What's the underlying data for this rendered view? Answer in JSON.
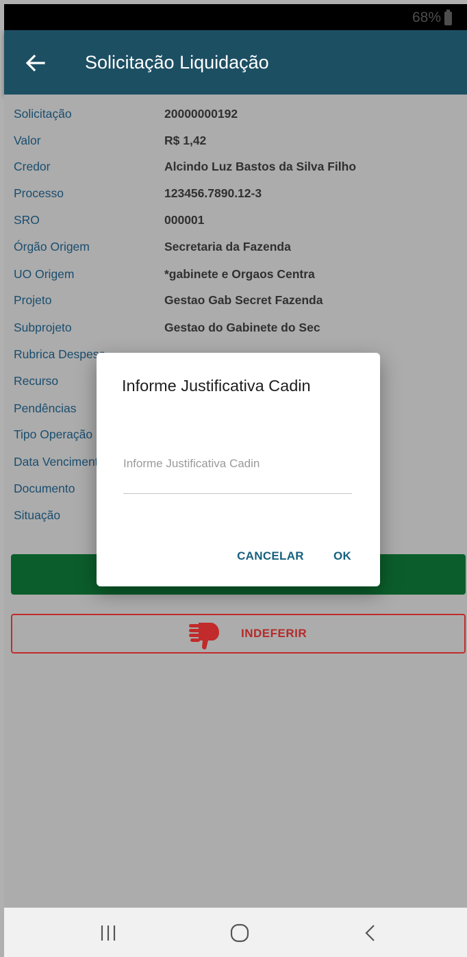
{
  "status_bar": {
    "battery": "68%"
  },
  "app_bar": {
    "title": "Solicitação Liquidação"
  },
  "fields": [
    {
      "label": "Solicitação",
      "value": "20000000192"
    },
    {
      "label": "Valor",
      "value": "R$ 1,42"
    },
    {
      "label": "Credor",
      "value": "Alcindo Luz Bastos da Silva Filho"
    },
    {
      "label": "Processo",
      "value": "123456.7890.12-3"
    },
    {
      "label": "SRO",
      "value": "000001"
    },
    {
      "label": "Órgão Origem",
      "value": "Secretaria da Fazenda"
    },
    {
      "label": "UO Origem",
      "value": "*gabinete e Orgaos Centra"
    },
    {
      "label": "Projeto",
      "value": "Gestao Gab Secret Fazenda"
    },
    {
      "label": "Subprojeto",
      "value": "Gestao do Gabinete do Sec"
    },
    {
      "label": "Rubrica Despesa",
      "value": ""
    },
    {
      "label": "Recurso",
      "value": ""
    },
    {
      "label": "Pendências",
      "value": ""
    },
    {
      "label": "Tipo Operação",
      "value": ""
    },
    {
      "label": "Data Vencimento",
      "value": ""
    },
    {
      "label": "Documento",
      "value": ""
    },
    {
      "label": "Situação",
      "value": ""
    }
  ],
  "actions": {
    "reject_label": "INDEFERIR"
  },
  "dialog": {
    "title": "Informe Justificativa Cadin",
    "input_placeholder": "Informe Justificativa Cadin",
    "input_value": "",
    "cancel_label": "CANCELAR",
    "ok_label": "OK"
  },
  "colors": {
    "app_bar": "#1d4f63",
    "approve": "#0b5e2b",
    "reject": "#c12b2b",
    "dialog_button": "#17607f"
  }
}
